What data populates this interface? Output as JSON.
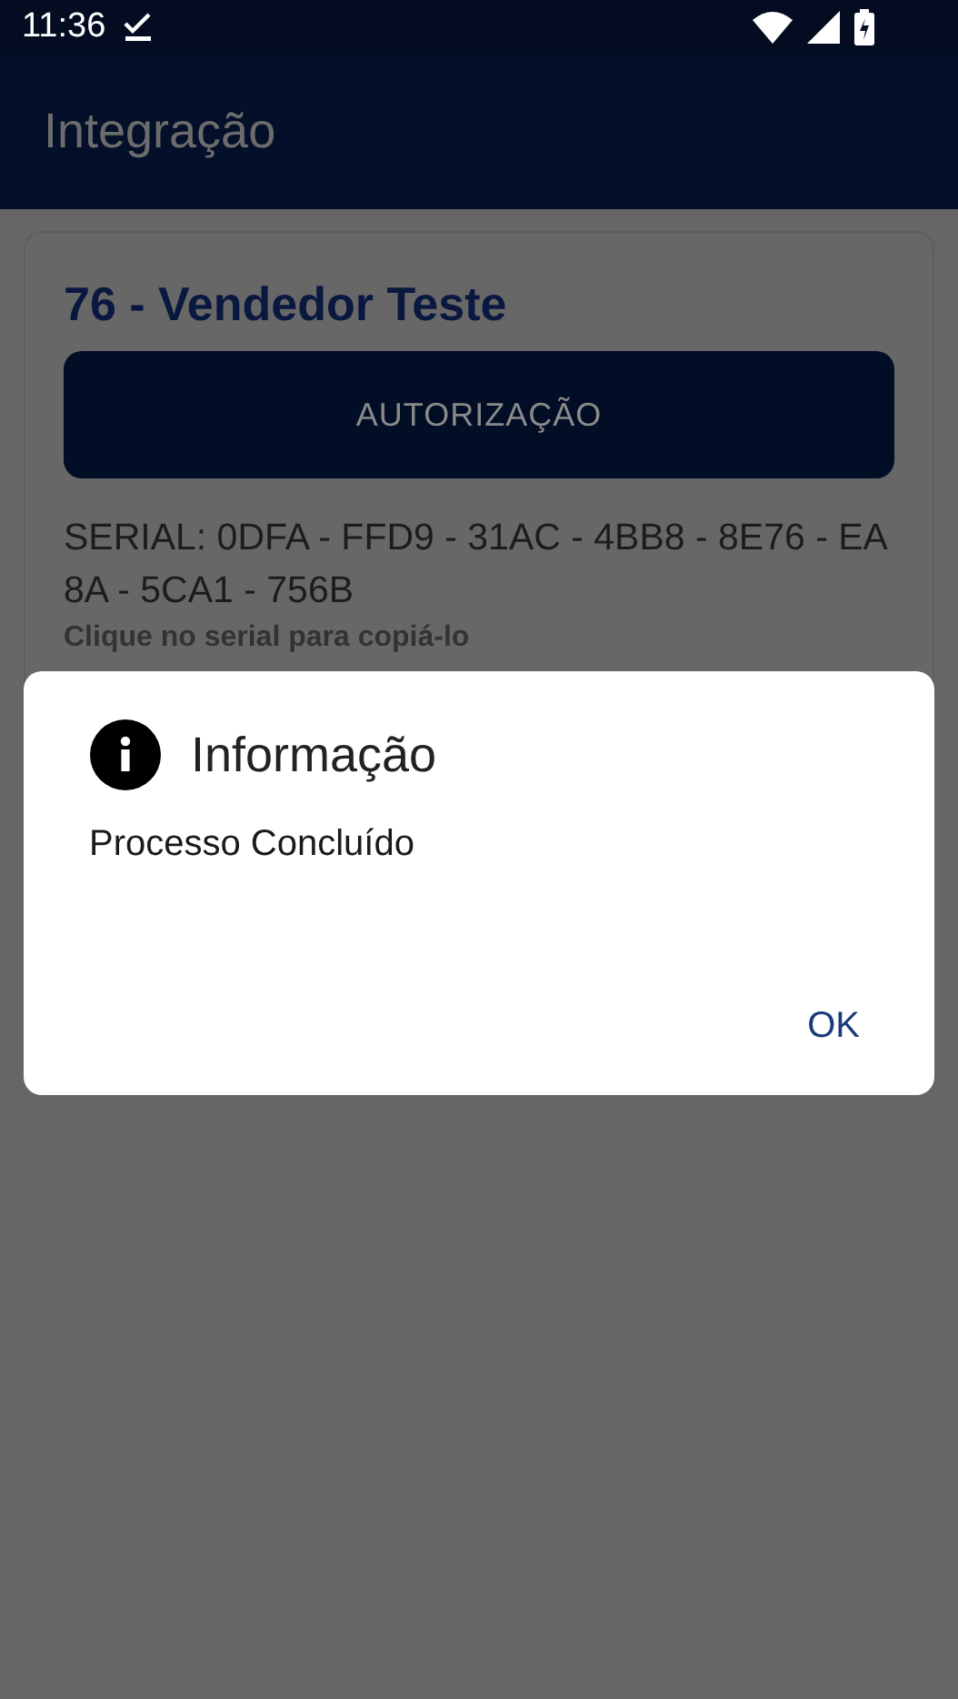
{
  "status_bar": {
    "time": "11:36"
  },
  "app_bar": {
    "title": "Integração"
  },
  "card": {
    "title": "76 - Vendedor Teste",
    "button": "AUTORIZAÇÃO",
    "serial": "SERIAL: 0DFA - FFD9 - 31AC - 4BB8 - 8E76 - EA8A - 5CA1 - 756B",
    "hint": "Clique no serial para copiá-lo"
  },
  "dialog": {
    "title": "Informação",
    "message": "Processo Concluído",
    "buttons": [
      "OK"
    ]
  }
}
